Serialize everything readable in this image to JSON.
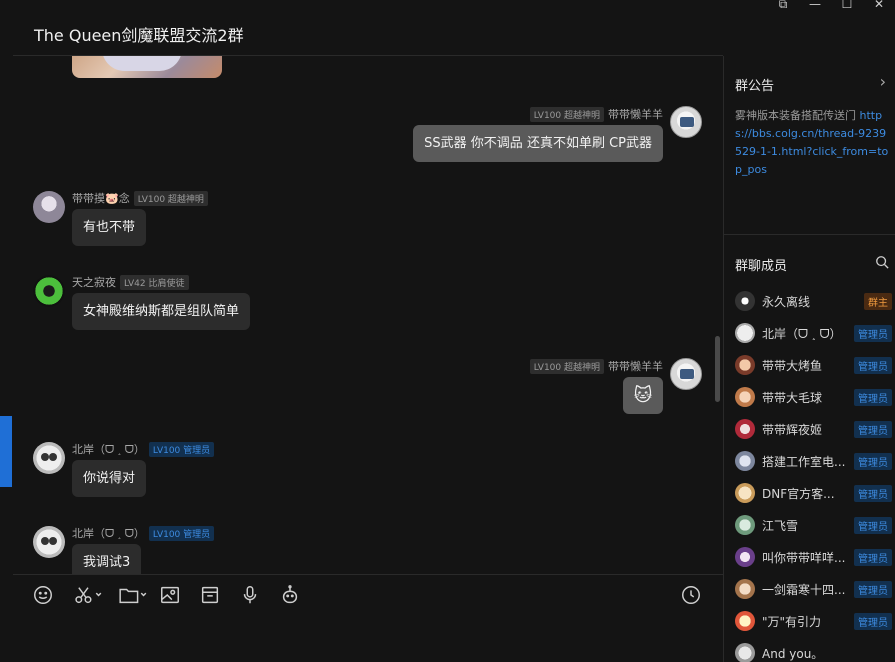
{
  "window": {
    "title": "The Queen剑魔联盟交流2群",
    "controls": [
      "⧉",
      "—",
      "☐",
      "✕"
    ]
  },
  "messages": [
    {
      "sender": "带带懒羊羊",
      "level": "LV100 超越神明",
      "text": "SS武器 你不调品 还真不如单刷 CP武器"
    },
    {
      "sender": "带带摸🐷念",
      "level": "LV100 超越神明",
      "text": "有也不带"
    },
    {
      "sender": "天之寂夜",
      "level": "LV42 比肩使徒",
      "text": "女神殿维纳斯都是组队简单"
    },
    {
      "sender": "带带懒羊羊",
      "level": "LV100 超越神明",
      "text": "🐱"
    },
    {
      "sender": "北岸（ᗜ ˰ ᗜ）",
      "level": "LV100 管理员",
      "text": "你说得对"
    },
    {
      "sender": "北岸（ᗜ ˰ ᗜ）",
      "level": "LV100 管理员",
      "text": "我调试3"
    }
  ],
  "toolbar": {
    "icons": [
      "emoji-icon",
      "scissors-icon",
      "folder-icon",
      "image-icon",
      "box-icon",
      "microphone-icon",
      "robot-icon",
      "history-icon"
    ]
  },
  "sidebar": {
    "announcement_title": "群公告",
    "announcement_prefix": "雾神版本装备搭配传送门 ",
    "announcement_link": "https://bbs.colg.cn/thread-9239529-1-1.html?click_from=top_pos",
    "members_title": "群聊成员",
    "members": [
      {
        "name": "永久离线",
        "role": "群主"
      },
      {
        "name": "北岸（ᗜ ˰ ᗜ）",
        "role": "管理员"
      },
      {
        "name": "带带大烤鱼",
        "role": "管理员"
      },
      {
        "name": "带带大毛球",
        "role": "管理员"
      },
      {
        "name": "带带辉夜姬",
        "role": "管理员"
      },
      {
        "name": "搭建工作室电...",
        "role": "管理员"
      },
      {
        "name": "DNF官方客...",
        "role": "管理员"
      },
      {
        "name": "江飞雪",
        "role": "管理员"
      },
      {
        "name": "叫你带带咩咩...",
        "role": "管理员"
      },
      {
        "name": "一剑霜寒十四...",
        "role": "管理员"
      },
      {
        "name": "\"万\"有引力",
        "role": "管理员"
      },
      {
        "name": "And you。",
        "role": ""
      }
    ]
  },
  "colors": {
    "background": "#141414",
    "accent": "#1f6fd6",
    "link": "#3d8be0",
    "owner_badge": "#f09a3e"
  }
}
